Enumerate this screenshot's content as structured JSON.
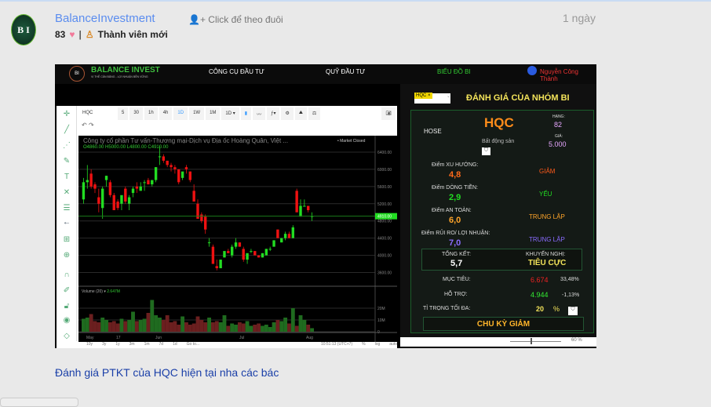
{
  "post": {
    "author": "BalanceInvestment",
    "follow": "Click để theo đuôi",
    "time": "1 ngày",
    "likes": "83",
    "rank": "Thành viên mới",
    "caption": "Đánh giá PTKT của HQC hiện tại nha các bác",
    "avatar_text": "B I"
  },
  "site": {
    "brand": "BALANCE INVEST",
    "slogan": "VỊ THẾ CÂN BẰNG - LỢI NHUẬN BỀN VỮNG",
    "nav": [
      "CÔNG CỤ ĐẦU TƯ",
      "QUỸ ĐẦU TƯ",
      "BIỂU ĐỒ BI"
    ],
    "user": "Nguyễn Công Thành"
  },
  "toolbar": {
    "symbol": "HQC",
    "intervals": [
      "5",
      "30",
      "1h",
      "4h",
      "1D",
      "1W",
      "1M",
      "1D ▾"
    ],
    "icons": [
      "candles-icon",
      "line-icon",
      "indicator-icon",
      "gear-icon",
      "compare-icon",
      "scale-icon",
      "camera-icon"
    ]
  },
  "chart_data": {
    "type": "candlestick",
    "title": "Công ty cổ phần Tư vấn-Thương mại-Dịch vụ Địa ốc Hoàng Quân, Việt ...",
    "ohlc_label": "O4860.00  H5000.00  L4800.00  C4910.00",
    "status": "• Market Closed",
    "last_price": "4910.00",
    "ylim": [
      3500,
      6600
    ],
    "yticks": [
      6400,
      6000,
      5600,
      5200,
      4800,
      4400,
      4000,
      3600
    ],
    "xticks": [
      "May",
      "17",
      "Jun",
      "Jul",
      "Aug"
    ],
    "volume_label": "Volume (20) ▾",
    "volume_value": "2.647M",
    "volume_ticks": [
      "20M",
      "10M",
      "0"
    ],
    "colors": {
      "up": "#22dd22",
      "down": "#ee1111"
    },
    "candles": [
      [
        5300,
        5800,
        5200,
        5700
      ],
      [
        5700,
        6100,
        5550,
        5750
      ],
      [
        5900,
        6000,
        5550,
        5600
      ],
      [
        5650,
        5700,
        5450,
        5550
      ],
      [
        5350,
        5550,
        5000,
        5200
      ],
      [
        5100,
        5600,
        4850,
        5550
      ],
      [
        5750,
        5850,
        5600,
        5850
      ],
      [
        5700,
        5750,
        5350,
        5400
      ],
      [
        5400,
        5450,
        5050,
        5050
      ],
      [
        5250,
        5300,
        5050,
        5100
      ],
      [
        5200,
        5350,
        5050,
        5400
      ],
      [
        5550,
        5600,
        5200,
        5250
      ],
      [
        5200,
        5400,
        5050,
        5350
      ],
      [
        5450,
        5600,
        5350,
        5550
      ],
      [
        5600,
        5700,
        5450,
        5550
      ],
      [
        5500,
        5700,
        5500,
        5600
      ],
      [
        5700,
        5750,
        5500,
        5700
      ],
      [
        5750,
        5800,
        5650,
        5650
      ],
      [
        5650,
        5750,
        5600,
        5750
      ],
      [
        5750,
        6050,
        5700,
        6050
      ],
      [
        6300,
        6550,
        6100,
        6300
      ],
      [
        6300,
        6350,
        6150,
        6200
      ],
      [
        6200,
        6200,
        6050,
        6100
      ],
      [
        6100,
        6150,
        5950,
        6050
      ],
      [
        6050,
        6100,
        5900,
        6000
      ],
      [
        6000,
        5850,
        5650,
        5700
      ],
      [
        5800,
        5850,
        5750,
        5950
      ],
      [
        6050,
        6100,
        5900,
        6000
      ],
      [
        5950,
        5950,
        5700,
        5750
      ],
      [
        5500,
        5650,
        5250,
        5250
      ],
      [
        5200,
        5300,
        4850,
        4850
      ],
      [
        4950,
        5000,
        4750,
        4800
      ],
      [
        4900,
        4950,
        4500,
        4600
      ],
      [
        4300,
        4400,
        4200,
        4300
      ],
      [
        4200,
        4250,
        3800,
        3800
      ],
      [
        3750,
        3900,
        3650,
        3700
      ],
      [
        3700,
        3900,
        3700,
        3900
      ],
      [
        3950,
        4100,
        3950,
        4100
      ],
      [
        4100,
        4150,
        4050,
        4050
      ],
      [
        4000,
        4250,
        3950,
        4200
      ],
      [
        4200,
        4400,
        4150,
        4300
      ],
      [
        4300,
        4300,
        4200,
        4200
      ],
      [
        4150,
        4200,
        3850,
        3900
      ],
      [
        3900,
        4050,
        3800,
        4050
      ],
      [
        4100,
        4150,
        4050,
        4100
      ],
      [
        4100,
        4100,
        4000,
        4000
      ],
      [
        4000,
        4000,
        3950,
        3950
      ],
      [
        3950,
        4050,
        3950,
        4050
      ],
      [
        4000,
        4150,
        4000,
        4150
      ],
      [
        4150,
        4200,
        4100,
        4150
      ],
      [
        4200,
        4350,
        4200,
        4350
      ],
      [
        4600,
        4600,
        4400,
        4400
      ],
      [
        4300,
        4400,
        4300,
        4400
      ],
      [
        4400,
        4550,
        4350,
        4500
      ],
      [
        4500,
        4550,
        4400,
        4400
      ],
      [
        4400,
        4700,
        4400,
        4650
      ],
      [
        5500,
        5550,
        5000,
        5000
      ],
      [
        4900,
        5300,
        4900,
        5150
      ],
      [
        5150,
        5300,
        5150,
        5150
      ],
      [
        5150,
        5150,
        5000,
        5050
      ],
      [
        4900,
        5000,
        4800,
        4910
      ]
    ],
    "volume": [
      11,
      12,
      15,
      9,
      8,
      12,
      10,
      8,
      9,
      7,
      11,
      9,
      10,
      17,
      9,
      10,
      11,
      16,
      27,
      14,
      12,
      10,
      14,
      8,
      9,
      6,
      13,
      8,
      6,
      7,
      13,
      10,
      8,
      12,
      8,
      9,
      8,
      14,
      5,
      7,
      6,
      8,
      7,
      9,
      5,
      6,
      7,
      5,
      6,
      4,
      8,
      10,
      9,
      12,
      7,
      20,
      5,
      14,
      10,
      6,
      3
    ]
  },
  "panel": {
    "symbol_select": "HQC ×",
    "title": "ĐÁNH GIÁ CỦA NHÓM BI",
    "exchange": "HOSE",
    "ticker": "HQC",
    "sector": "Bất động sản",
    "rank_label": "HẠNG:",
    "rank": "82",
    "price_label": "GIÁ:",
    "price": "5.000",
    "scores": [
      {
        "label": "Điểm XU HƯỚNG:",
        "value": "4,8",
        "verdict": "GIẢM",
        "color": "#ff6a1a",
        "vcolor": "#ff5a1a"
      },
      {
        "label": "Điểm DÒNG TIỀN:",
        "value": "2,9",
        "verdict": "YẾU",
        "color": "#22dd22",
        "vcolor": "#22dd22"
      },
      {
        "label": "Điểm AN TOÀN:",
        "value": "6,0",
        "verdict": "TRUNG LẬP",
        "color": "#ffa52a",
        "vcolor": "#ffa52a"
      },
      {
        "label": "Điểm RỦI RO/ LỢI NHUẬN:",
        "value": "7,0",
        "verdict": "TRUNG LẬP",
        "color": "#8a6cff",
        "vcolor": "#8a6cff"
      }
    ],
    "summary_label": "TỔNG KẾT:",
    "summary": "5,7",
    "advice_label": "KHUYẾN NGHỊ:",
    "advice": "TIÊU CỰC",
    "target_label": "MỤC TIÊU:",
    "target": "6.674",
    "target_pct": "33,48%",
    "support_label": "HỖ TRỢ:",
    "support": "4.944",
    "support_pct": "-1,13%",
    "weight_label": "TỈ TRỌNG TỐI ĐA:",
    "weight": "20",
    "weight_unit": "%",
    "cycle": "CHU KỲ GIẢM",
    "zoom": "60 %"
  },
  "timebar": {
    "ranges": [
      "10y",
      "3y",
      "1y",
      "3m",
      "1m",
      "7d",
      "1d",
      "Go to..."
    ],
    "clock": "10:51:13 (UTC+7)",
    "opts": [
      "%",
      "log",
      "auto"
    ]
  }
}
